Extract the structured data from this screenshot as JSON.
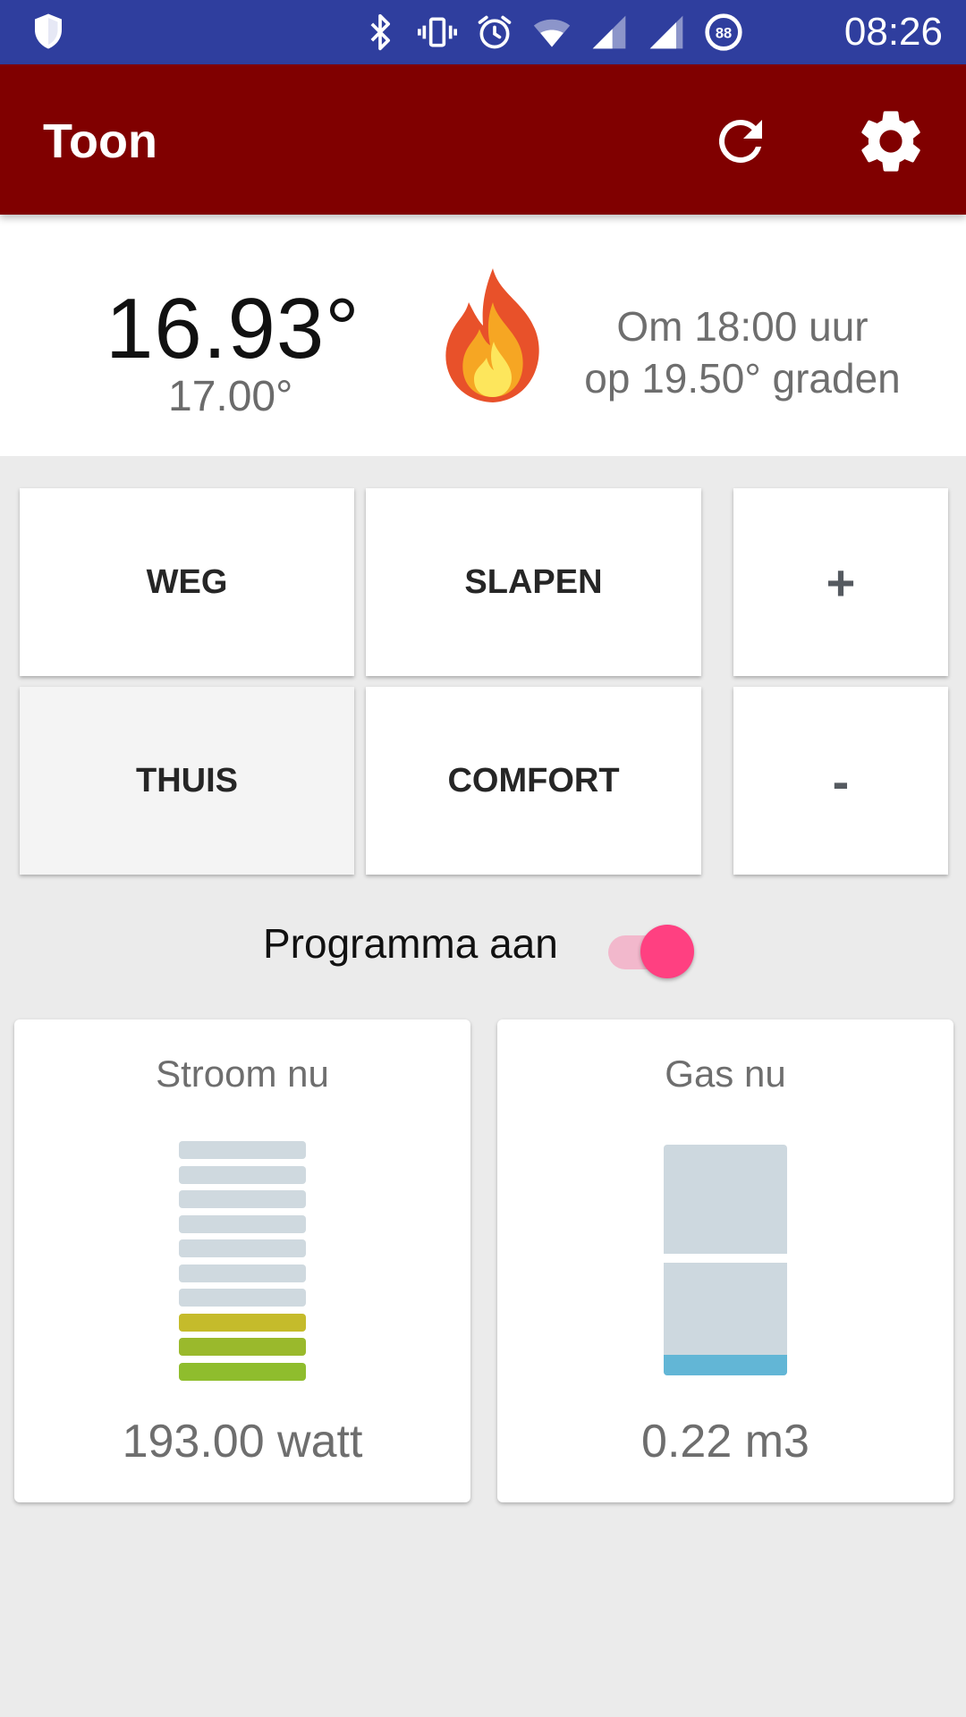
{
  "statusbar": {
    "time": "08:26",
    "icons": [
      "shield-icon",
      "bluetooth-icon",
      "vibrate-icon",
      "alarm-icon",
      "wifi-icon",
      "signal-icon",
      "signal-icon",
      "data-saver-icon"
    ],
    "battery_badge": "88"
  },
  "appbar": {
    "title": "Toon",
    "refresh_icon": "refresh-icon",
    "settings_icon": "gear-icon",
    "color": "#800000"
  },
  "temperature": {
    "current": "16.93°",
    "target": "17.00°",
    "status_icon": "flame-icon",
    "schedule_line1": "Om 18:00 uur",
    "schedule_line2": "op 19.50° graden"
  },
  "modes": {
    "weg": "WEG",
    "slapen": "SLAPEN",
    "plus": "+",
    "thuis": "THUIS",
    "comfort": "COMFORT",
    "minus": "-",
    "active": "THUIS"
  },
  "program": {
    "label": "Programma aan",
    "enabled": true,
    "accent": "#ff4081"
  },
  "cards": {
    "power": {
      "title": "Stroom nu",
      "value": "193.00 watt",
      "segments_total": 10,
      "segments_lit": 3
    },
    "gas": {
      "title": "Gas nu",
      "value": "0.22 m3",
      "fill_fraction": 0.09,
      "fill_color": "#62b6d6"
    }
  }
}
